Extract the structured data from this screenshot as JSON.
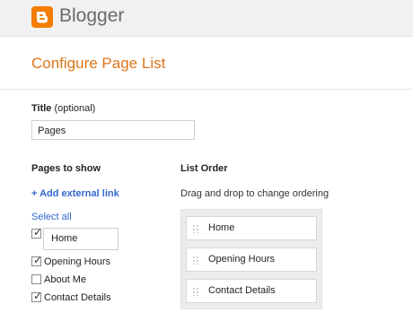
{
  "header": {
    "brand": "Blogger",
    "logo_icon": "blogger-logo-icon"
  },
  "page": {
    "title": "Configure Page List"
  },
  "title_field": {
    "label": "Title",
    "optional": "(optional)",
    "value": "Pages"
  },
  "pages_to_show": {
    "heading": "Pages to show",
    "add_link": "+ Add external link",
    "select_all": "Select all",
    "items": [
      {
        "label": "Home",
        "checked": true
      },
      {
        "label": "Opening Hours",
        "checked": true
      },
      {
        "label": "About Me",
        "checked": false
      },
      {
        "label": "Contact Details",
        "checked": true
      }
    ]
  },
  "list_order": {
    "heading": "List Order",
    "hint": "Drag and drop to change ordering",
    "items": [
      "Home",
      "Opening Hours",
      "Contact Details"
    ]
  },
  "colors": {
    "brand_orange": "#f57d00",
    "title_orange": "#dd7518",
    "link_blue": "#3366cc"
  }
}
